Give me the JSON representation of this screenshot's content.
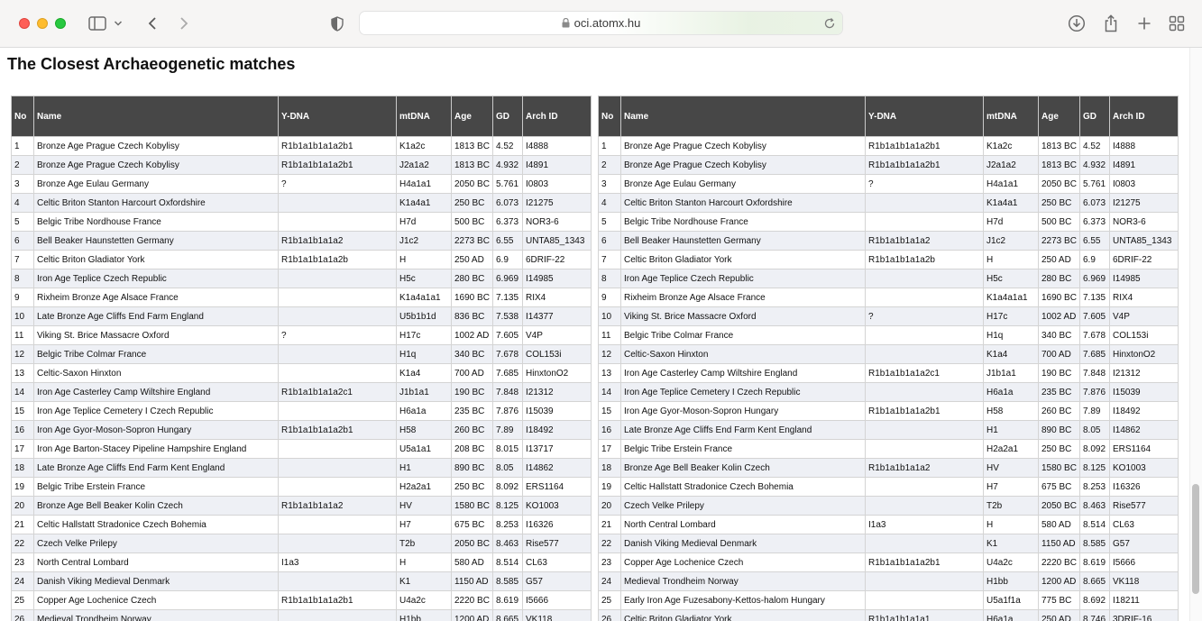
{
  "browser": {
    "url": "oci.atomx.hu"
  },
  "page": {
    "title": "The Closest Archaeogenetic matches"
  },
  "columns": [
    "No",
    "Name",
    "Y-DNA",
    "mtDNA",
    "Age",
    "GD",
    "Arch ID"
  ],
  "left_table": [
    [
      "1",
      "Bronze Age Prague Czech Kobylisy",
      "R1b1a1b1a1a2b1",
      "K1a2c",
      "1813 BC",
      "4.52",
      "I4888"
    ],
    [
      "2",
      "Bronze Age Prague Czech Kobylisy",
      "R1b1a1b1a1a2b1",
      "J2a1a2",
      "1813 BC",
      "4.932",
      "I4891"
    ],
    [
      "3",
      "Bronze Age Eulau Germany",
      "?",
      "H4a1a1",
      "2050 BC",
      "5.761",
      "I0803"
    ],
    [
      "4",
      "Celtic Briton Stanton Harcourt Oxfordshire",
      "",
      "K1a4a1",
      "250 BC",
      "6.073",
      "I21275"
    ],
    [
      "5",
      "Belgic Tribe Nordhouse France",
      "",
      "H7d",
      "500 BC",
      "6.373",
      "NOR3-6"
    ],
    [
      "6",
      "Bell Beaker Haunstetten Germany",
      "R1b1a1b1a1a2",
      "J1c2",
      "2273 BC",
      "6.55",
      "UNTA85_1343"
    ],
    [
      "7",
      "Celtic Briton Gladiator York",
      "R1b1a1b1a1a2b",
      "H",
      "250 AD",
      "6.9",
      "6DRIF-22"
    ],
    [
      "8",
      "Iron Age Teplice Czech Republic",
      "",
      "H5c",
      "280 BC",
      "6.969",
      "I14985"
    ],
    [
      "9",
      "Rixheim Bronze Age Alsace France",
      "",
      "K1a4a1a1",
      "1690 BC",
      "7.135",
      "RIX4"
    ],
    [
      "10",
      "Late Bronze Age Cliffs End Farm England",
      "",
      "U5b1b1d",
      "836 BC",
      "7.538",
      "I14377"
    ],
    [
      "11",
      "Viking St. Brice Massacre Oxford",
      "?",
      "H17c",
      "1002 AD",
      "7.605",
      "V4P"
    ],
    [
      "12",
      "Belgic Tribe Colmar France",
      "",
      "H1q",
      "340 BC",
      "7.678",
      "COL153i"
    ],
    [
      "13",
      "Celtic-Saxon Hinxton",
      "",
      "K1a4",
      "700 AD",
      "7.685",
      "HinxtonO2"
    ],
    [
      "14",
      "Iron Age Casterley Camp Wiltshire England",
      "R1b1a1b1a1a2c1",
      "J1b1a1",
      "190 BC",
      "7.848",
      "I21312"
    ],
    [
      "15",
      "Iron Age Teplice Cemetery I Czech Republic",
      "",
      "H6a1a",
      "235 BC",
      "7.876",
      "I15039"
    ],
    [
      "16",
      "Iron Age Gyor-Moson-Sopron Hungary",
      "R1b1a1b1a1a2b1",
      "H58",
      "260 BC",
      "7.89",
      "I18492"
    ],
    [
      "17",
      "Iron Age Barton-Stacey Pipeline Hampshire England",
      "",
      "U5a1a1",
      "208 BC",
      "8.015",
      "I13717"
    ],
    [
      "18",
      "Late Bronze Age Cliffs End Farm Kent England",
      "",
      "H1",
      "890 BC",
      "8.05",
      "I14862"
    ],
    [
      "19",
      "Belgic Tribe Erstein France",
      "",
      "H2a2a1",
      "250 BC",
      "8.092",
      "ERS1164"
    ],
    [
      "20",
      "Bronze Age Bell Beaker Kolin Czech",
      "R1b1a1b1a1a2",
      "HV",
      "1580 BC",
      "8.125",
      "KO1003"
    ],
    [
      "21",
      "Celtic Hallstatt Stradonice Czech Bohemia",
      "",
      "H7",
      "675 BC",
      "8.253",
      "I16326"
    ],
    [
      "22",
      "Czech Velke Prilepy",
      "",
      "T2b",
      "2050 BC",
      "8.463",
      "Rise577"
    ],
    [
      "23",
      "North Central Lombard",
      "I1a3",
      "H",
      "580 AD",
      "8.514",
      "CL63"
    ],
    [
      "24",
      "Danish Viking Medieval Denmark",
      "",
      "K1",
      "1150 AD",
      "8.585",
      "G57"
    ],
    [
      "25",
      "Copper Age Lochenice Czech",
      "R1b1a1b1a1a2b1",
      "U4a2c",
      "2220 BC",
      "8.619",
      "I5666"
    ],
    [
      "26",
      "Medieval Trondheim Norway",
      "",
      "H1bb",
      "1200 AD",
      "8.665",
      "VK118"
    ]
  ],
  "right_table": [
    [
      "1",
      "Bronze Age Prague Czech Kobylisy",
      "R1b1a1b1a1a2b1",
      "K1a2c",
      "1813 BC",
      "4.52",
      "I4888"
    ],
    [
      "2",
      "Bronze Age Prague Czech Kobylisy",
      "R1b1a1b1a1a2b1",
      "J2a1a2",
      "1813 BC",
      "4.932",
      "I4891"
    ],
    [
      "3",
      "Bronze Age Eulau Germany",
      "?",
      "H4a1a1",
      "2050 BC",
      "5.761",
      "I0803"
    ],
    [
      "4",
      "Celtic Briton Stanton Harcourt Oxfordshire",
      "",
      "K1a4a1",
      "250 BC",
      "6.073",
      "I21275"
    ],
    [
      "5",
      "Belgic Tribe Nordhouse France",
      "",
      "H7d",
      "500 BC",
      "6.373",
      "NOR3-6"
    ],
    [
      "6",
      "Bell Beaker Haunstetten Germany",
      "R1b1a1b1a1a2",
      "J1c2",
      "2273 BC",
      "6.55",
      "UNTA85_1343"
    ],
    [
      "7",
      "Celtic Briton Gladiator York",
      "R1b1a1b1a1a2b",
      "H",
      "250 AD",
      "6.9",
      "6DRIF-22"
    ],
    [
      "8",
      "Iron Age Teplice Czech Republic",
      "",
      "H5c",
      "280 BC",
      "6.969",
      "I14985"
    ],
    [
      "9",
      "Rixheim Bronze Age Alsace France",
      "",
      "K1a4a1a1",
      "1690 BC",
      "7.135",
      "RIX4"
    ],
    [
      "10",
      "Viking St. Brice Massacre Oxford",
      "?",
      "H17c",
      "1002 AD",
      "7.605",
      "V4P"
    ],
    [
      "11",
      "Belgic Tribe Colmar France",
      "",
      "H1q",
      "340 BC",
      "7.678",
      "COL153i"
    ],
    [
      "12",
      "Celtic-Saxon Hinxton",
      "",
      "K1a4",
      "700 AD",
      "7.685",
      "HinxtonO2"
    ],
    [
      "13",
      "Iron Age Casterley Camp Wiltshire England",
      "R1b1a1b1a1a2c1",
      "J1b1a1",
      "190 BC",
      "7.848",
      "I21312"
    ],
    [
      "14",
      "Iron Age Teplice Cemetery I Czech Republic",
      "",
      "H6a1a",
      "235 BC",
      "7.876",
      "I15039"
    ],
    [
      "15",
      "Iron Age Gyor-Moson-Sopron Hungary",
      "R1b1a1b1a1a2b1",
      "H58",
      "260 BC",
      "7.89",
      "I18492"
    ],
    [
      "16",
      "Late Bronze Age Cliffs End Farm Kent England",
      "",
      "H1",
      "890 BC",
      "8.05",
      "I14862"
    ],
    [
      "17",
      "Belgic Tribe Erstein France",
      "",
      "H2a2a1",
      "250 BC",
      "8.092",
      "ERS1164"
    ],
    [
      "18",
      "Bronze Age Bell Beaker Kolin Czech",
      "R1b1a1b1a1a2",
      "HV",
      "1580 BC",
      "8.125",
      "KO1003"
    ],
    [
      "19",
      "Celtic Hallstatt Stradonice Czech Bohemia",
      "",
      "H7",
      "675 BC",
      "8.253",
      "I16326"
    ],
    [
      "20",
      "Czech Velke Prilepy",
      "",
      "T2b",
      "2050 BC",
      "8.463",
      "Rise577"
    ],
    [
      "21",
      "North Central Lombard",
      "I1a3",
      "H",
      "580 AD",
      "8.514",
      "CL63"
    ],
    [
      "22",
      "Danish Viking Medieval Denmark",
      "",
      "K1",
      "1150 AD",
      "8.585",
      "G57"
    ],
    [
      "23",
      "Copper Age Lochenice Czech",
      "R1b1a1b1a1a2b1",
      "U4a2c",
      "2220 BC",
      "8.619",
      "I5666"
    ],
    [
      "24",
      "Medieval Trondheim Norway",
      "",
      "H1bb",
      "1200 AD",
      "8.665",
      "VK118"
    ],
    [
      "25",
      "Early Iron Age Fuzesabony-Kettos-halom Hungary",
      "",
      "U5a1f1a",
      "775 BC",
      "8.692",
      "I18211"
    ],
    [
      "26",
      "Celtic Briton Gladiator York",
      "R1b1a1b1a1a1",
      "H6a1a",
      "250 AD",
      "8.746",
      "3DRIF-16"
    ]
  ]
}
